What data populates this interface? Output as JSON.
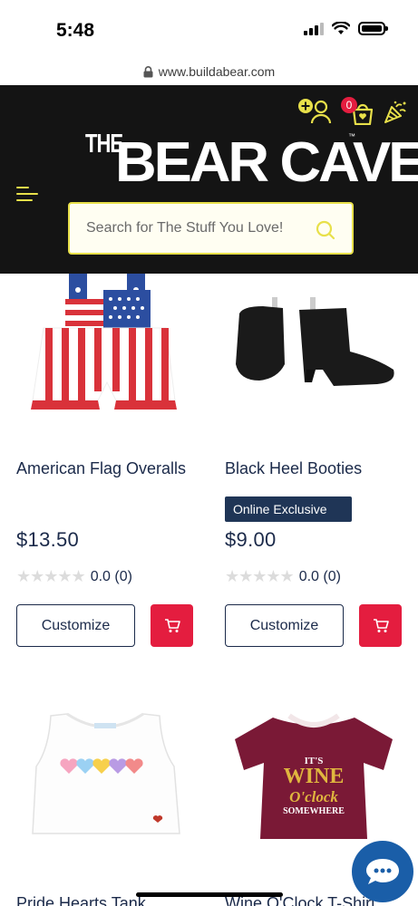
{
  "status_bar": {
    "time": "5:48"
  },
  "browser": {
    "url": "www.buildabear.com"
  },
  "header": {
    "logo_small": "THE",
    "logo_main_1": "BEAR",
    "logo_main_2": "CAVE",
    "logo_tm": "™",
    "cart_count": "0",
    "search_placeholder": "Search for The Stuff You Love!",
    "accent_color": "#e8e04a"
  },
  "products": [
    {
      "name": "American Flag Overalls",
      "badge": "",
      "price": "$13.50",
      "rating": "0.0 (0)",
      "customize_label": "Customize"
    },
    {
      "name": "Black Heel Booties",
      "badge": "Online Exclusive",
      "price": "$9.00",
      "rating": "0.0 (0)",
      "customize_label": "Customize"
    },
    {
      "name": "Pride Hearts Tank",
      "tank_hearts": [
        "#f6a5c0",
        "#9bd1f3",
        "#f7d04c",
        "#b99be4",
        "#f28a8a",
        "#f6a5c0"
      ]
    },
    {
      "name": "Wine O'Clock T-Shirt",
      "shirt_line1": "IT'S",
      "shirt_line2": "WINE",
      "shirt_line3": "O'clock",
      "shirt_line4": "SOMEWHERE"
    }
  ],
  "stars": "★★★★★",
  "colors": {
    "header_bg": "#141414",
    "cart_red": "#e41d3f",
    "navy": "#1b2a4a",
    "chat_blue": "#1a5ea8"
  }
}
